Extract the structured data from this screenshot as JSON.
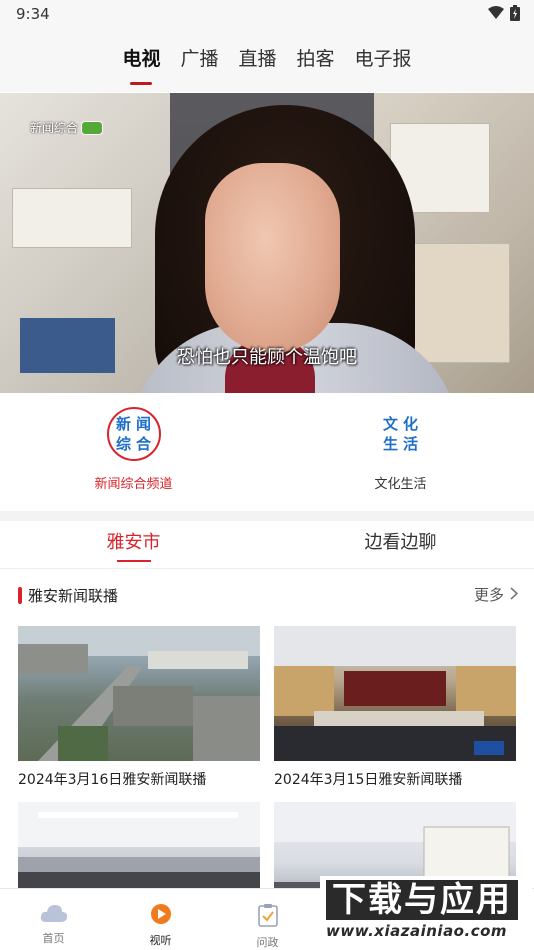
{
  "status_bar": {
    "time": "9:34"
  },
  "top_tabs": [
    {
      "label": "电视",
      "active": true
    },
    {
      "label": "广播",
      "active": false
    },
    {
      "label": "直播",
      "active": false
    },
    {
      "label": "拍客",
      "active": false
    },
    {
      "label": "电子报",
      "active": false
    }
  ],
  "video": {
    "channel_logo": "新闻综合",
    "subtitle": "恐怕也只能顾个温饱吧"
  },
  "channels": [
    {
      "logo_chars": [
        "新",
        "闻",
        "综",
        "合"
      ],
      "label": "新闻综合频道",
      "active": true
    },
    {
      "logo_chars": [
        "文",
        "化",
        "生",
        "活"
      ],
      "label": "文化生活",
      "active": false
    }
  ],
  "sub_tabs": [
    {
      "label": "雅安市",
      "active": true
    },
    {
      "label": "边看边聊",
      "active": false
    }
  ],
  "section": {
    "title": "雅安新闻联播",
    "more": "更多"
  },
  "news": [
    {
      "title": "2024年3月16日雅安新闻联播"
    },
    {
      "title": "2024年3月15日雅安新闻联播"
    },
    {
      "title": ""
    },
    {
      "title": ""
    }
  ],
  "bottom_nav": [
    {
      "label": "首页",
      "icon": "cloud-home-icon",
      "active": false
    },
    {
      "label": "视听",
      "icon": "play-circle-icon",
      "active": true
    },
    {
      "label": "问政",
      "icon": "clipboard-check-icon",
      "active": false
    }
  ],
  "watermark": {
    "main": "下载与应用",
    "sub": "www.xiazainiao.com"
  },
  "colors": {
    "accent": "#d8232a",
    "logo_blue": "#1e6fc8"
  }
}
